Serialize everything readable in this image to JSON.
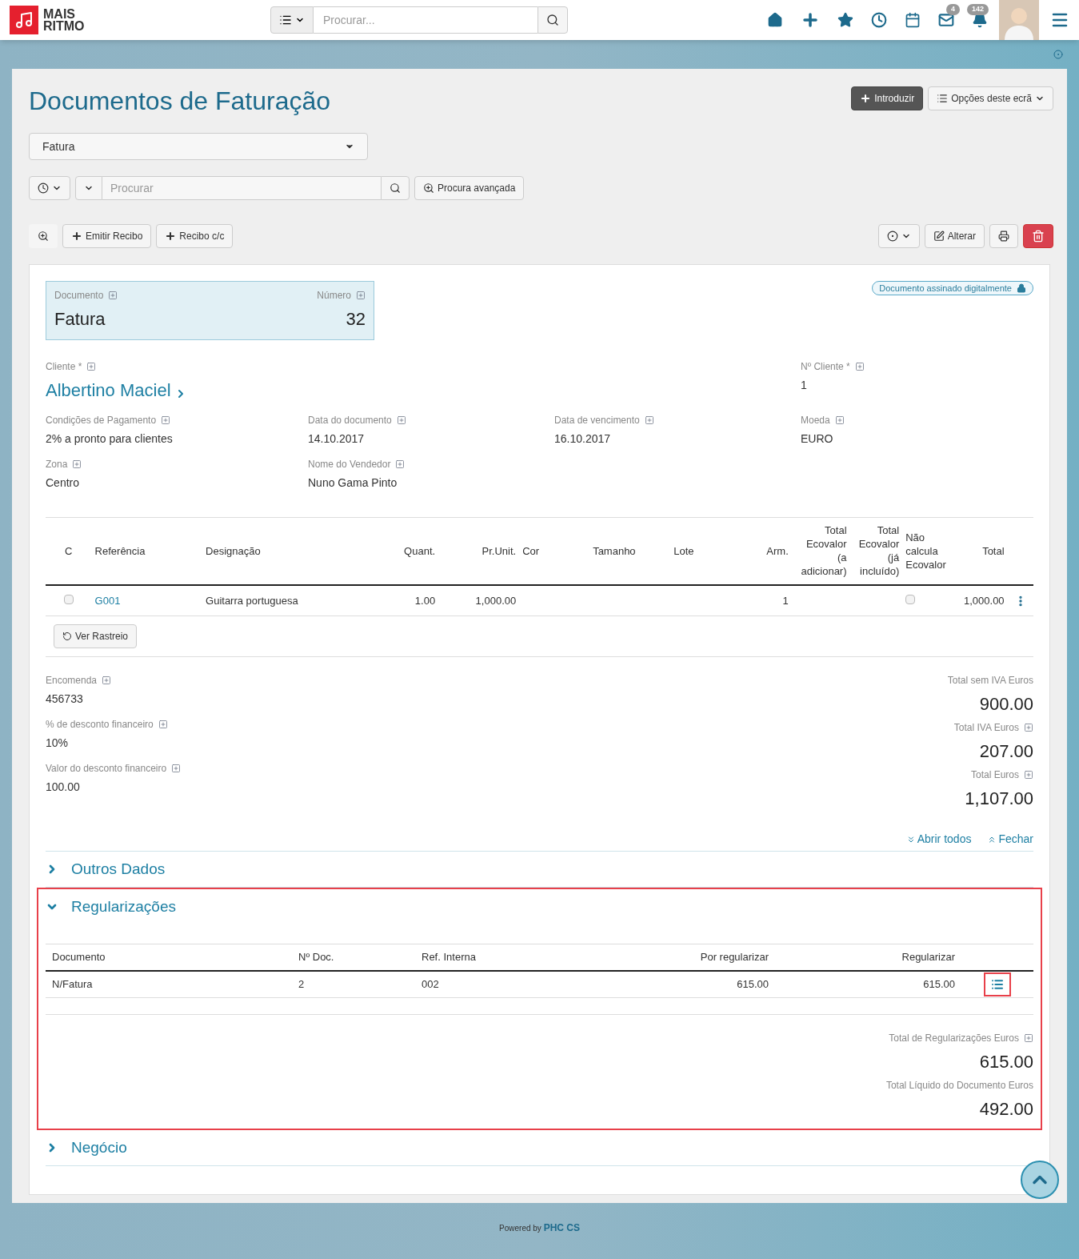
{
  "topbar": {
    "logo": [
      "MAIS",
      "RITMO"
    ],
    "search_placeholder": "Procurar...",
    "mail_badge": "4",
    "bell_badge": "142"
  },
  "page": {
    "title": "Documentos de Faturação",
    "introduce": "Introduzir",
    "options": "Opções deste ecrã"
  },
  "doc_type": {
    "value": "Fatura"
  },
  "search": {
    "placeholder": "Procurar",
    "advanced": "Procura avançada"
  },
  "toolbar": {
    "actions": [
      "Emitir Recibo",
      "Recibo c/c"
    ],
    "edit": "Alterar"
  },
  "document": {
    "signed_badge": "Documento assinado digitalmente",
    "doc_label": "Documento",
    "doc_value": "Fatura",
    "num_label": "Número",
    "num_value": "32",
    "client_label": "Cliente *",
    "client_value": "Albertino Maciel",
    "client_no_label": "Nº Cliente *",
    "client_no_value": "1",
    "fields": [
      {
        "label": "Condições de Pagamento",
        "value": "2% a pronto para clientes"
      },
      {
        "label": "Data do documento",
        "value": "14.10.2017"
      },
      {
        "label": "Data de vencimento",
        "value": "16.10.2017"
      },
      {
        "label": "Moeda",
        "value": "EURO"
      },
      {
        "label": "Zona",
        "value": "Centro"
      },
      {
        "label": "Nome do Vendedor",
        "value": "Nuno Gama Pinto"
      }
    ]
  },
  "lines": {
    "columns": [
      "C",
      "Referência",
      "Designação",
      "Quant.",
      "Pr.Unit.",
      "Cor",
      "Tamanho",
      "Lote",
      "Arm.",
      "Total Ecovalor (a adicionar)",
      "Total Ecovalor (já incluído)",
      "Não calcula Ecovalor",
      "Total"
    ],
    "rows": [
      {
        "checked": false,
        "reference": "G001",
        "designation": "Guitarra portuguesa",
        "quantity": "1.00",
        "unit_price": "1,000.00",
        "warehouse": "1",
        "no_ecovalor": false,
        "total": "1,000.00"
      }
    ],
    "trace_button": "Ver Rastreio"
  },
  "extra_fields": [
    {
      "label": "Encomenda",
      "value": "456733"
    },
    {
      "label": "% de desconto financeiro",
      "value": "10%"
    },
    {
      "label": "Valor do desconto financeiro",
      "value": "100.00"
    }
  ],
  "totals": [
    {
      "label": "Total sem IVA Euros",
      "value": "900.00",
      "expandable": false
    },
    {
      "label": "Total IVA Euros",
      "value": "207.00",
      "expandable": true
    },
    {
      "label": "Total Euros",
      "value": "1,107.00",
      "expandable": true
    }
  ],
  "expand_all": "Abrir todos",
  "collapse_all": "Fechar",
  "sections": [
    {
      "title": "Outros Dados",
      "expanded": false,
      "highlighted": false
    },
    {
      "title": "Regularizações",
      "expanded": true,
      "highlighted": true,
      "columns": [
        "Documento",
        "Nº Doc.",
        "Ref. Interna",
        "Por regularizar",
        "Regularizar"
      ],
      "rows": [
        {
          "cells": [
            "N/Fatura",
            "2",
            "002",
            "615.00",
            "615.00"
          ],
          "action_highlighted": true
        }
      ],
      "totals": [
        {
          "label": "Total de Regularizações Euros",
          "value": "615.00",
          "expandable": true
        },
        {
          "label": "Total Líquido do Documento Euros",
          "value": "492.00",
          "expandable": false
        }
      ]
    },
    {
      "title": "Negócio",
      "expanded": false,
      "highlighted": false
    }
  ],
  "footer": {
    "prefix": "Powered by",
    "brand": "PHC CS"
  }
}
